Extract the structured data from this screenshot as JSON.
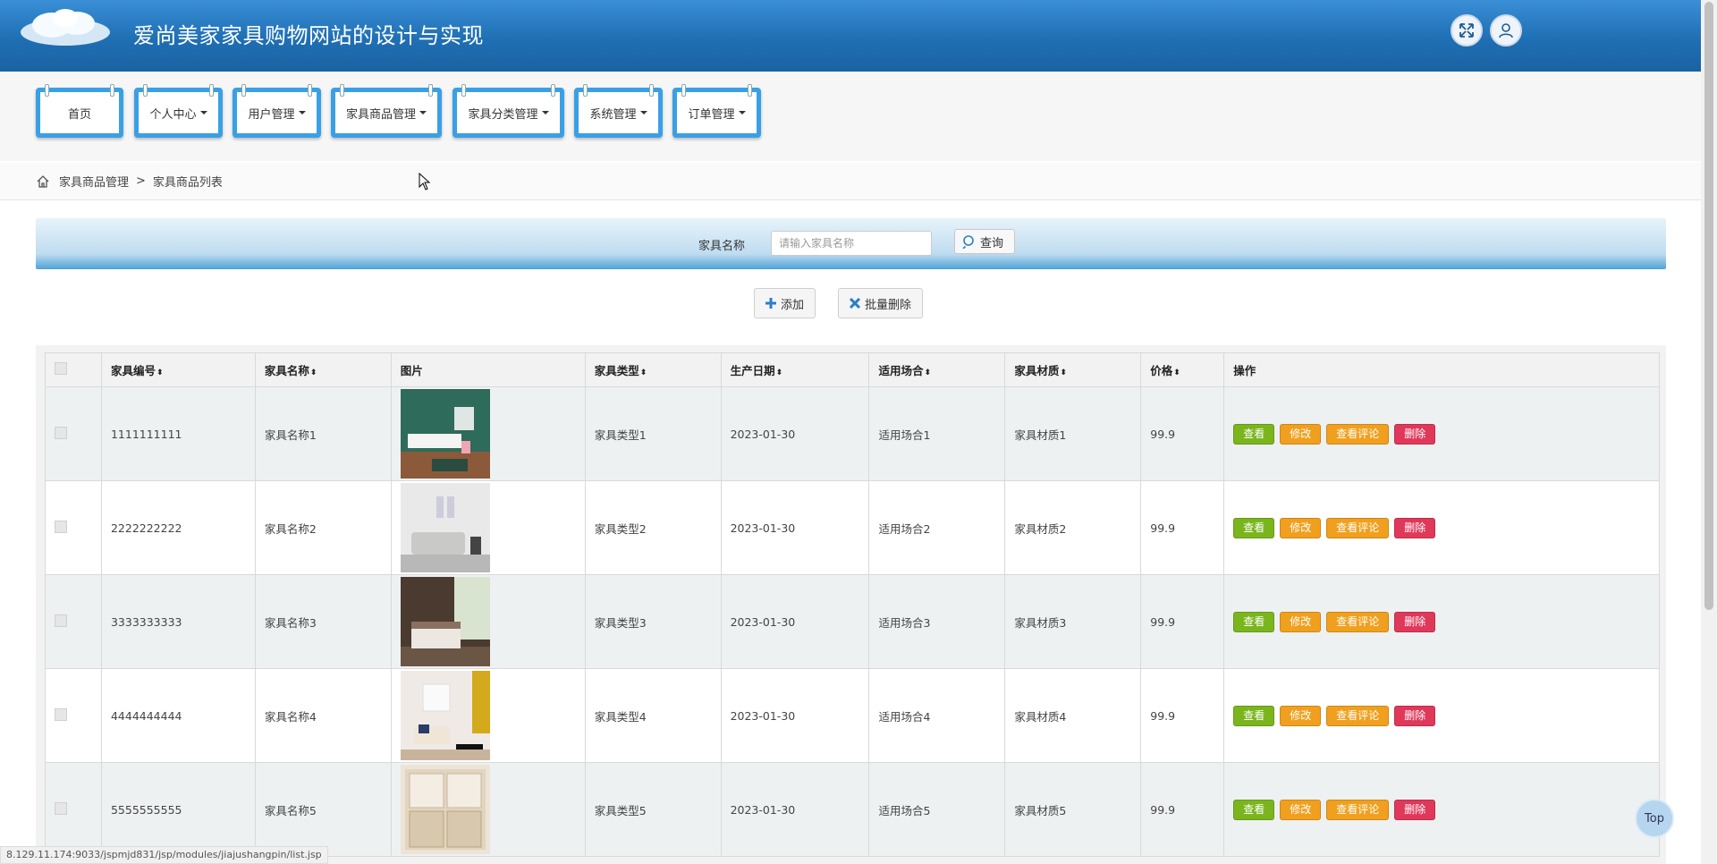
{
  "header": {
    "title": "爱尚美家家具购物网站的设计与实现",
    "fullscreen_icon": "expand-icon",
    "user_icon": "user-icon"
  },
  "nav": {
    "items": [
      {
        "label": "首页",
        "dropdown": false
      },
      {
        "label": "个人中心",
        "dropdown": true
      },
      {
        "label": "用户管理",
        "dropdown": true
      },
      {
        "label": "家具商品管理",
        "dropdown": true
      },
      {
        "label": "家具分类管理",
        "dropdown": true
      },
      {
        "label": "系统管理",
        "dropdown": true
      },
      {
        "label": "订单管理",
        "dropdown": true
      }
    ]
  },
  "breadcrumb": {
    "home_icon": "home-icon",
    "level1": "家具商品管理",
    "separator": ">",
    "level2": "家具商品列表"
  },
  "search": {
    "label": "家具名称",
    "placeholder": "请输入家具名称",
    "value": "",
    "button": "查询"
  },
  "actions": {
    "add": "添加",
    "batch_delete": "批量删除"
  },
  "table": {
    "columns": [
      "家具编号",
      "家具名称",
      "图片",
      "家具类型",
      "生产日期",
      "适用场合",
      "家具材质",
      "价格",
      "操作"
    ],
    "sortable": [
      true,
      true,
      false,
      true,
      true,
      true,
      true,
      true,
      false
    ],
    "ops": {
      "view": "查看",
      "edit": "修改",
      "comment": "查看评论",
      "delete": "删除"
    },
    "rows": [
      {
        "id": "1111111111",
        "name": "家具名称1",
        "type": "家具类型1",
        "date": "2023-01-30",
        "occasion": "适用场合1",
        "material": "家具材质1",
        "price": "99.9"
      },
      {
        "id": "2222222222",
        "name": "家具名称2",
        "type": "家具类型2",
        "date": "2023-01-30",
        "occasion": "适用场合2",
        "material": "家具材质2",
        "price": "99.9"
      },
      {
        "id": "3333333333",
        "name": "家具名称3",
        "type": "家具类型3",
        "date": "2023-01-30",
        "occasion": "适用场合3",
        "material": "家具材质3",
        "price": "99.9"
      },
      {
        "id": "4444444444",
        "name": "家具名称4",
        "type": "家具类型4",
        "date": "2023-01-30",
        "occasion": "适用场合4",
        "material": "家具材质4",
        "price": "99.9"
      },
      {
        "id": "5555555555",
        "name": "家具名称5",
        "type": "家具类型5",
        "date": "2023-01-30",
        "occasion": "适用场合5",
        "material": "家具材质5",
        "price": "99.9"
      }
    ]
  },
  "status_url": "8.129.11.174:9033/jspmjd831/jsp/modules/jiajushangpin/list.jsp",
  "top_button": "Top",
  "colors": {
    "header": "#2a7fc6",
    "nav_border": "#3aa0e6",
    "view": "#7ab51d",
    "edit": "#f0a01e",
    "delete": "#e0385a"
  }
}
